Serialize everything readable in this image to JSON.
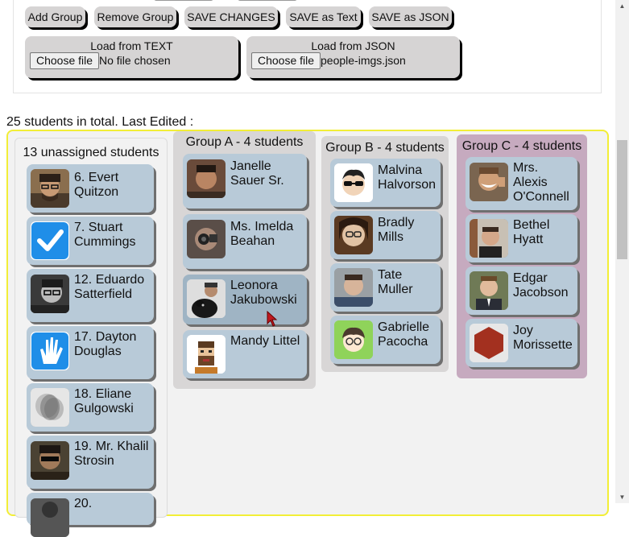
{
  "toolbar": {
    "add_group": "Add Group",
    "remove_group": "Remove Group",
    "save_changes": "SAVE CHANGES",
    "save_text": "SAVE as Text",
    "save_json": "SAVE as JSON"
  },
  "load_text": {
    "title": "Load from TEXT",
    "button": "Choose file",
    "file": "No file chosen"
  },
  "load_json": {
    "title": "Load from JSON",
    "button": "Choose file",
    "file": "people-imgs.json"
  },
  "status": "25 students in total. Last Edited :",
  "unassigned": {
    "title": "13 unassigned students",
    "items": [
      {
        "name": "6. Evert Quitzon",
        "avatar": "photo-man-glasses-icon"
      },
      {
        "name": "7. Stuart Cummings",
        "avatar": "checkmark-icon"
      },
      {
        "name": "12. Eduardo Satterfield",
        "avatar": "photo-man-bw-icon"
      },
      {
        "name": "17. Dayton Douglas",
        "avatar": "hand-icon"
      },
      {
        "name": "18. Eliane Gulgowski",
        "avatar": "photo-blurred-face-icon"
      },
      {
        "name": "19. Mr. Khalil Strosin",
        "avatar": "photo-man-sunglasses-icon"
      },
      {
        "name": "20.",
        "avatar": "photo-partial-icon"
      }
    ]
  },
  "group_a": {
    "title": "Group A - 4 students",
    "items": [
      {
        "name": "Janelle Sauer Sr.",
        "avatar": "photo-man-icon"
      },
      {
        "name": "Ms. Imelda Beahan",
        "avatar": "photo-camera-man-icon"
      },
      {
        "name": "Leonora Jakubowski",
        "avatar": "photo-dog-icon"
      },
      {
        "name": "Mandy Littel",
        "avatar": "pixel-bearded-man-icon"
      }
    ]
  },
  "group_b": {
    "title": "Group B - 4 students",
    "items": [
      {
        "name": "Malvina Halvorson",
        "avatar": "cartoon-sunglasses-icon"
      },
      {
        "name": "Bradly Mills",
        "avatar": "photo-woman-glasses-icon"
      },
      {
        "name": "Tate Muller",
        "avatar": "photo-man-icon"
      },
      {
        "name": "Gabrielle Pacocha",
        "avatar": "cartoon-green-glasses-icon"
      }
    ]
  },
  "group_c": {
    "title": "Group C - 4 students",
    "items": [
      {
        "name": "Mrs. Alexis O'Connell",
        "avatar": "photo-man-laughing-icon"
      },
      {
        "name": "Bethel Hyatt",
        "avatar": "photo-man-icon"
      },
      {
        "name": "Edgar Jacobson",
        "avatar": "photo-man-suit-icon"
      },
      {
        "name": "Joy Morissette",
        "avatar": "red-hexagon-icon"
      }
    ]
  },
  "colors": {
    "card": "#b8cad8",
    "group_a_bg": "#d8d6d6",
    "group_c_bg": "#c6aabf",
    "board_border": "#f2ee37"
  }
}
